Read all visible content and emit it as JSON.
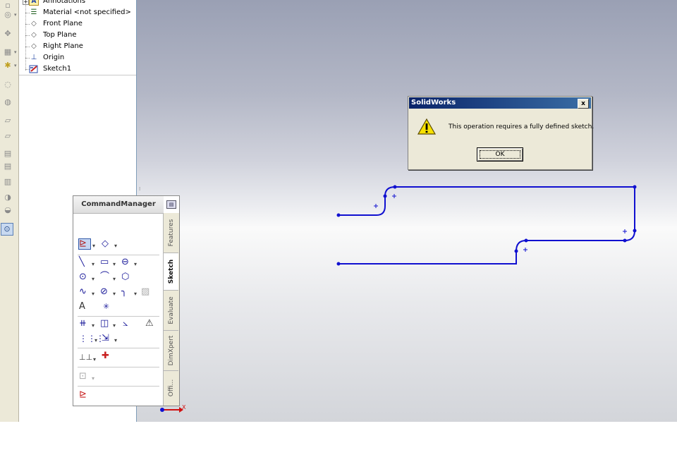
{
  "feature_tree": {
    "items": [
      {
        "label": "Annotations",
        "icon": "annotations-icon",
        "expandable": true
      },
      {
        "label": "Material <not specified>",
        "icon": "material-icon"
      },
      {
        "label": "Front Plane",
        "icon": "plane-icon"
      },
      {
        "label": "Top Plane",
        "icon": "plane-icon"
      },
      {
        "label": "Right Plane",
        "icon": "plane-icon"
      },
      {
        "label": "Origin",
        "icon": "origin-icon"
      },
      {
        "label": "Sketch1",
        "icon": "sketch-icon"
      }
    ]
  },
  "dialog": {
    "title": "SolidWorks",
    "close_label": "x",
    "message": "This operation requires a fully defined sketch.",
    "ok_label": "OK",
    "icon": "warning-icon"
  },
  "command_manager": {
    "title": "CommandManager",
    "tabs": [
      {
        "label": "Features",
        "active": false
      },
      {
        "label": "Sketch",
        "active": true
      },
      {
        "label": "Evaluate",
        "active": false
      },
      {
        "label": "DimXpert",
        "active": false
      },
      {
        "label": "Offi...",
        "active": false
      }
    ]
  },
  "colors": {
    "sketch_line": "#1010d0",
    "dialog_title_start": "#0a246a",
    "dialog_title_end": "#3a6ea5",
    "panel": "#ece9d8"
  },
  "triad": {
    "x_label": "X"
  }
}
